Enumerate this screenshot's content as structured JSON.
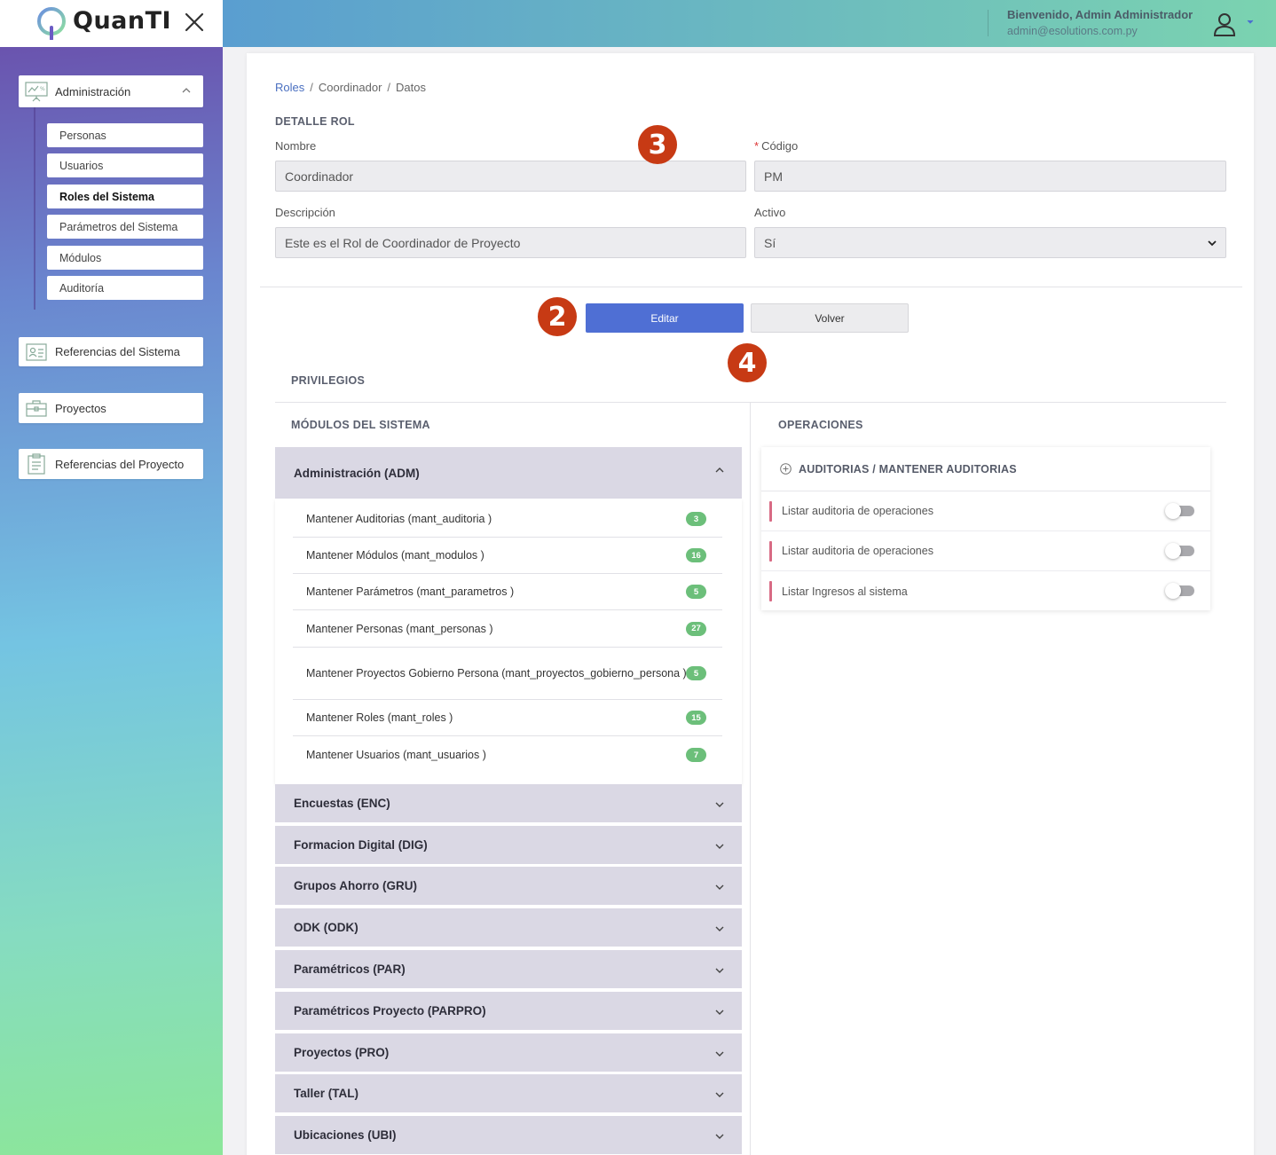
{
  "app": {
    "logo_text": "QuanTI"
  },
  "header": {
    "welcome": "Bienvenido, Admin Administrador",
    "email": "admin@esolutions.com.py"
  },
  "sidebar": {
    "groups": [
      {
        "label": "Administración",
        "icon": "presentation-board-icon",
        "expanded": true
      },
      {
        "label": "Referencias del Sistema",
        "icon": "id-card-icon"
      },
      {
        "label": "Proyectos",
        "icon": "briefcase-icon"
      },
      {
        "label": "Referencias del Proyecto",
        "icon": "clipboard-icon"
      }
    ],
    "admin_items": [
      {
        "label": "Personas"
      },
      {
        "label": "Usuarios"
      },
      {
        "label": "Roles del Sistema",
        "active": true
      },
      {
        "label": "Parámetros del Sistema"
      },
      {
        "label": "Módulos"
      },
      {
        "label": "Auditoría"
      }
    ]
  },
  "breadcrumb": {
    "root": "Roles",
    "middle": "Coordinador",
    "current": "Datos",
    "separator": "/"
  },
  "detail": {
    "title": "DETALLE ROL",
    "nombre_label": "Nombre",
    "nombre_value": "Coordinador",
    "codigo_required": "*",
    "codigo_label": "Código",
    "codigo_value": "PM",
    "descripcion_label": "Descripción",
    "descripcion_value": "Este es el Rol de Coordinador de Proyecto",
    "activo_label": "Activo",
    "activo_value": "Sí"
  },
  "buttons": {
    "edit": "Editar",
    "back": "Volver"
  },
  "markers": {
    "m3": "3",
    "m2": "2",
    "m4": "4"
  },
  "privileges": {
    "title": "PRIVILEGIOS",
    "modules_title": "MÓDULOS DEL SISTEMA",
    "operations_title": "OPERACIONES",
    "expanded_module": "Administración (ADM)",
    "submodules": [
      {
        "label": "Mantener Auditorias (mant_auditoria )",
        "count": "3"
      },
      {
        "label": "Mantener Módulos (mant_modulos )",
        "count": "16"
      },
      {
        "label": "Mantener Parámetros (mant_parametros )",
        "count": "5"
      },
      {
        "label": "Mantener Personas (mant_personas )",
        "count": "27"
      },
      {
        "label": "Mantener Proyectos Gobierno Persona (mant_proyectos_gobierno_persona )",
        "count": "5"
      },
      {
        "label": "Mantener Roles (mant_roles )",
        "count": "15"
      },
      {
        "label": "Mantener Usuarios (mant_usuarios )",
        "count": "7"
      }
    ],
    "collapsed_modules": [
      "Encuestas (ENC)",
      "Formacion Digital (DIG)",
      "Grupos Ahorro (GRU)",
      "ODK (ODK)",
      "Paramétricos (PAR)",
      "Paramétricos Proyecto (PARPRO)",
      "Proyectos (PRO)",
      "Taller (TAL)",
      "Ubicaciones (UBI)"
    ],
    "operations_header": "AUDITORIAS / MANTENER AUDITORIAS",
    "operations": [
      {
        "label": "Listar auditoria de operaciones",
        "enabled": false
      },
      {
        "label": "Listar auditoria de operaciones",
        "enabled": false
      },
      {
        "label": "Listar Ingresos al sistema",
        "enabled": false
      }
    ]
  },
  "colors": {
    "primary": "#4f6fd4",
    "marker": "#c73a14",
    "badge": "#6cbf7a",
    "op_bar": "#d86a84",
    "accordion": "#dad8e4"
  }
}
